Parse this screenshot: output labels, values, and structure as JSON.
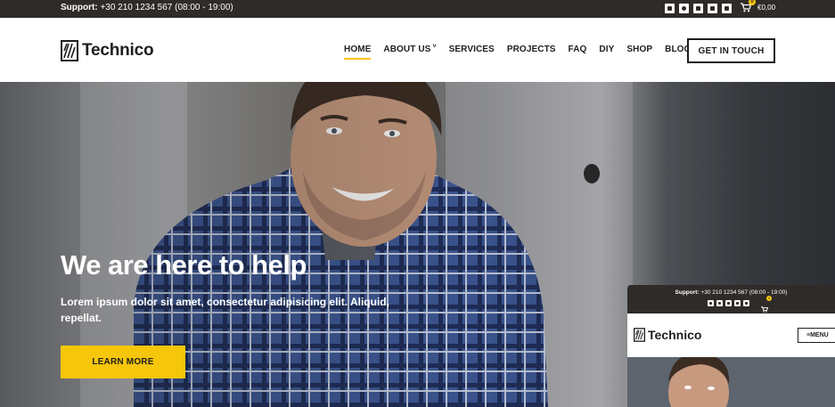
{
  "topbar": {
    "support_label": "Support:",
    "support_value": "+30 210 1234 567 (08:00 - 19:00)",
    "social_icons": [
      "linkedin-icon",
      "instagram-icon",
      "twitter-icon",
      "facebook-icon",
      "youtube-icon"
    ],
    "cart_count": "0",
    "cart_total": "€0,00"
  },
  "header": {
    "logo_text": "Technico",
    "nav": [
      {
        "label": "HOME",
        "active": true
      },
      {
        "label": "ABOUT US",
        "has_dropdown": true
      },
      {
        "label": "SERVICES"
      },
      {
        "label": "PROJECTS"
      },
      {
        "label": "FAQ"
      },
      {
        "label": "DIY"
      },
      {
        "label": "SHOP"
      },
      {
        "label": "BLOG"
      }
    ],
    "cta_label": "GET IN TOUCH"
  },
  "hero": {
    "title": "We are here to help",
    "text": "Lorem ipsum dolor sit amet, consectetur adipisicing elit. Aliquid, repellat.",
    "button_label": "LEARN MORE"
  },
  "mobile_preview": {
    "support_label": "Support:",
    "support_value": "+30 210 1234 567 (08:00 - 19:00)",
    "cart_count": "0",
    "logo_text": "Technico",
    "menu_label": "MENU"
  },
  "colors": {
    "accent": "#f6c60b",
    "dark": "#2f2b29",
    "text": "#1e1e1e"
  }
}
